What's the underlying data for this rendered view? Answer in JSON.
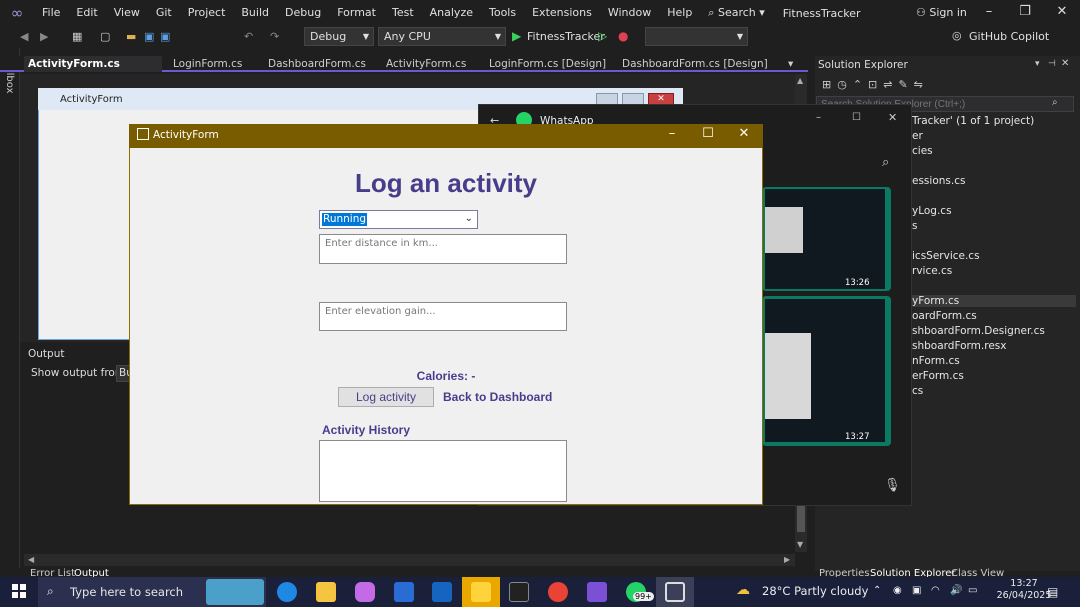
{
  "menubar": {
    "items": [
      "File",
      "Edit",
      "View",
      "Git",
      "Project",
      "Build",
      "Debug",
      "Format",
      "Test",
      "Analyze",
      "Tools",
      "Extensions",
      "Window",
      "Help"
    ],
    "search": "Search",
    "app_title": "FitnessTracker",
    "sign_in": "Sign in"
  },
  "toolbar": {
    "config": "Debug",
    "platform": "Any CPU",
    "run_target": "FitnessTracker",
    "copilot": "GitHub Copilot"
  },
  "tabs": [
    {
      "label": "ActivityForm.cs [Design]",
      "active": true
    },
    {
      "label": "LoginForm.cs"
    },
    {
      "label": "DashboardForm.cs"
    },
    {
      "label": "ActivityForm.cs"
    },
    {
      "label": "LoginForm.cs [Design]"
    },
    {
      "label": "DashboardForm.cs [Design]"
    }
  ],
  "toolbox": {
    "label": "Toolbox"
  },
  "designer": {
    "form_title": "ActivityForm"
  },
  "output": {
    "title": "Output",
    "show_from": "Show output from:",
    "combo": "Bu",
    "tabs": [
      "Error List",
      "Output"
    ]
  },
  "solution_explorer": {
    "title": "Solution Explorer",
    "search_placeholder": "Search Solution Explorer (Ctrl+;)",
    "items": [
      "Tracker' (1 of 1 project)",
      "er",
      "cies",
      "essions.cs",
      "yLog.cs",
      "s",
      "icsService.cs",
      "rvice.cs",
      "yForm.cs",
      "oardForm.cs",
      "shboardForm.Designer.cs",
      "shboardForm.resx",
      "nForm.cs",
      "erForm.cs",
      "cs"
    ],
    "selected_index": 8,
    "bottom_tabs": [
      "Properties",
      "Solution Explorer",
      "Class View"
    ]
  },
  "whatsapp": {
    "title": "WhatsApp",
    "thumb_times": [
      "13:26",
      "13:27"
    ]
  },
  "activity_form": {
    "title": "ActivityForm",
    "heading": "Log an activity",
    "activity_type": "Running",
    "distance_placeholder": "Enter distance in km...",
    "elevation_placeholder": "Enter elevation gain...",
    "calories": "Calories: -",
    "log_button": "Log activity",
    "back_button": "Back to Dashboard",
    "history_label": "Activity History"
  },
  "taskbar": {
    "search_placeholder": "Type here to search",
    "weather": "28°C  Partly cloudy",
    "time": "13:27",
    "date": "26/04/2025",
    "whatsapp_badge": "99+"
  },
  "colors": {
    "accent": "#483d8b",
    "form_titlebar": "#7a5c00",
    "tab_accent": "#6b5acd"
  }
}
